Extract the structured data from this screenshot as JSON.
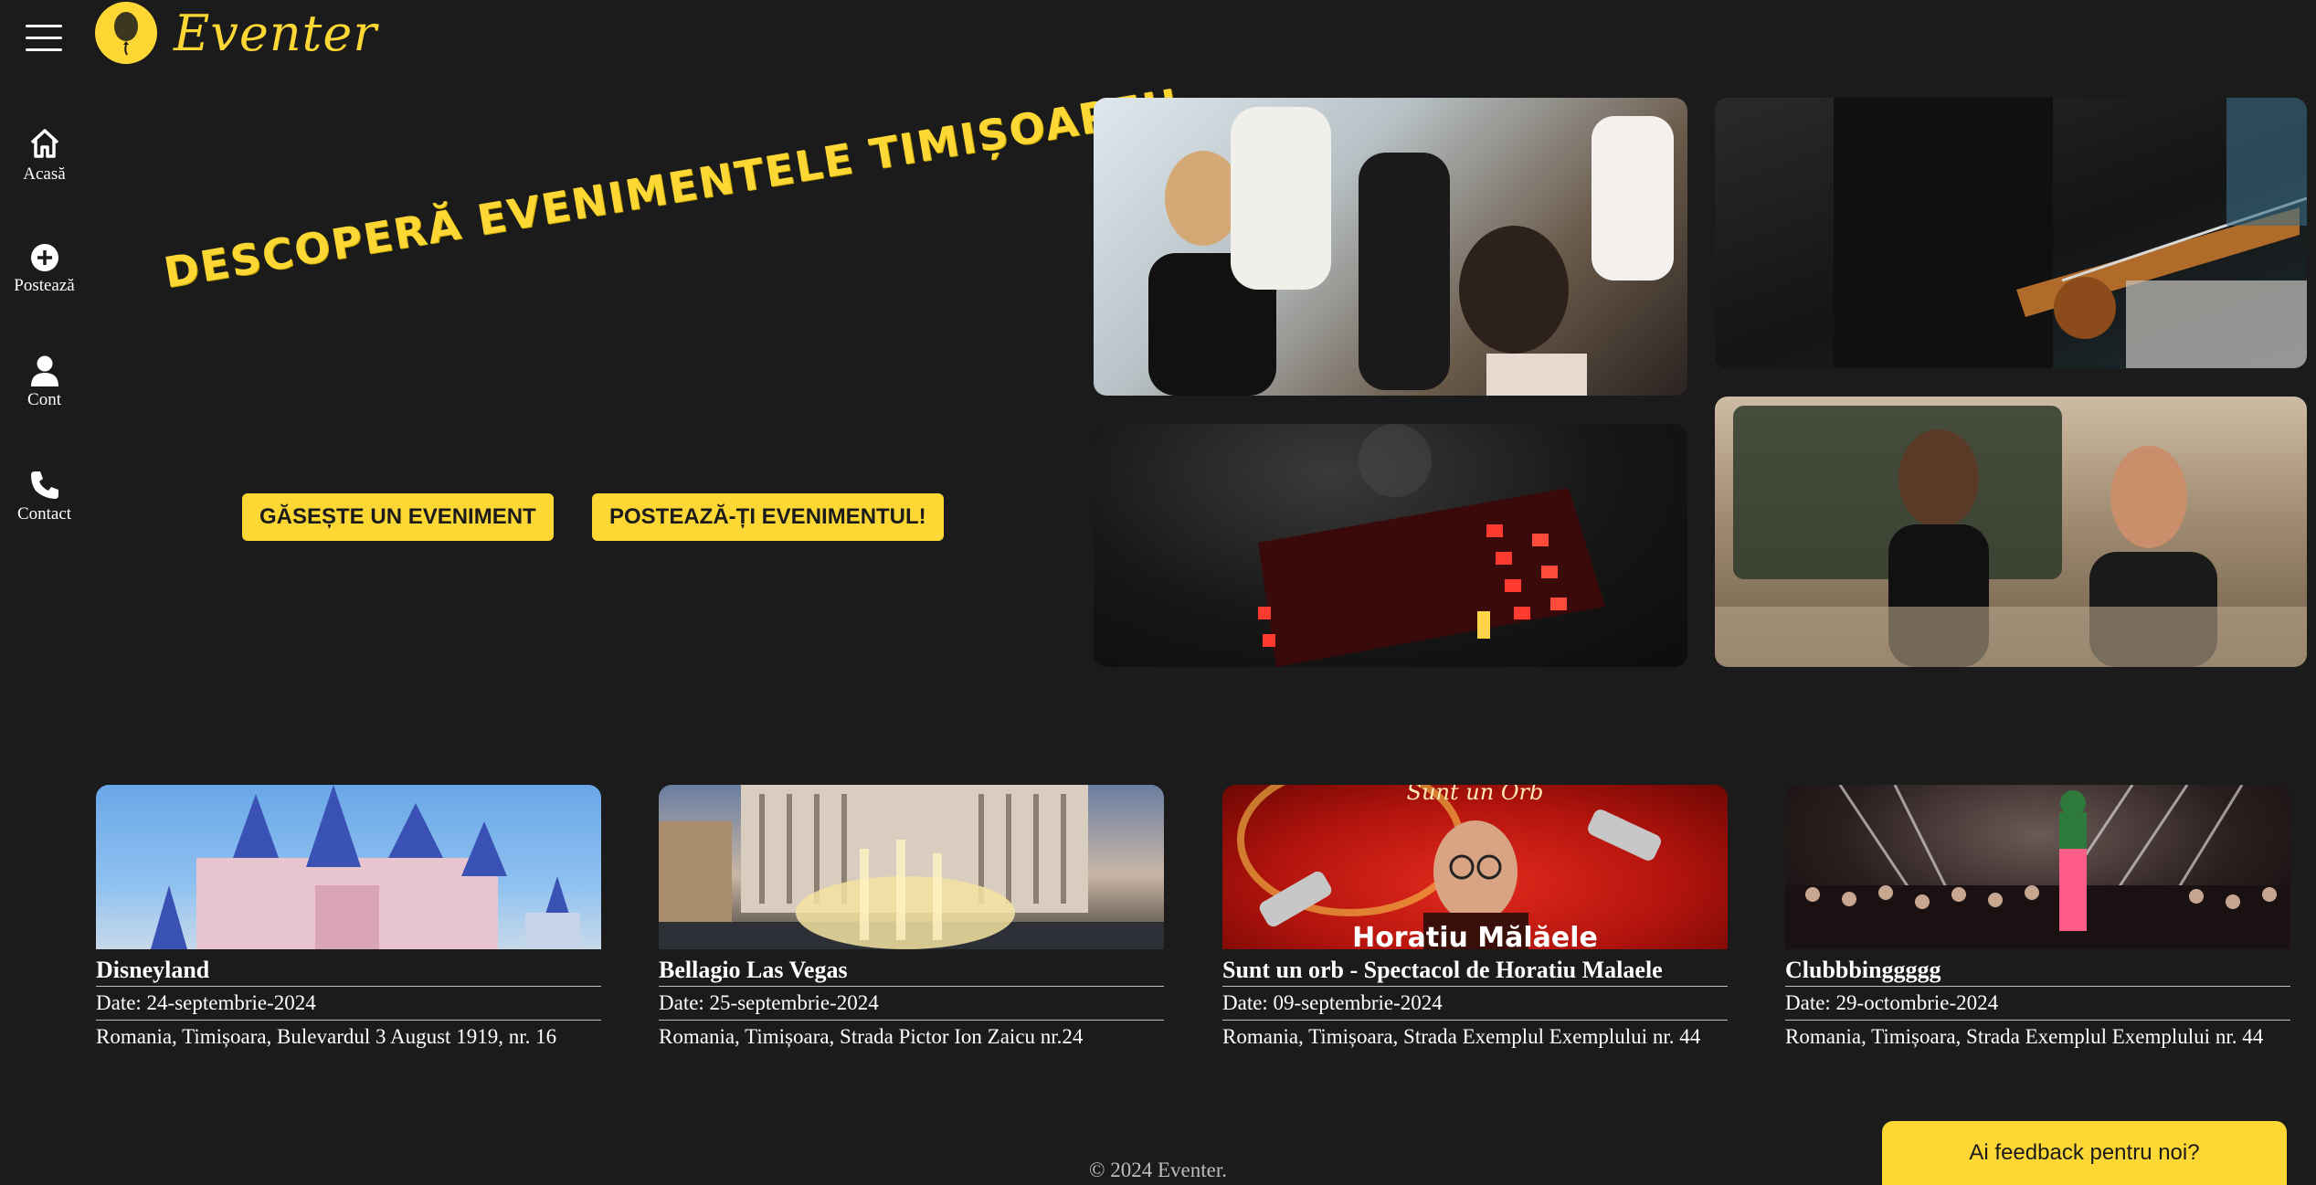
{
  "app": {
    "name": "Eventer"
  },
  "colors": {
    "accent": "#fdd835",
    "background": "#1b1b1b",
    "text": "#ffffff"
  },
  "sidebar": {
    "items": [
      {
        "label": "Acasă",
        "icon": "home-icon"
      },
      {
        "label": "Postează",
        "icon": "plus-circle-icon"
      },
      {
        "label": "Cont",
        "icon": "user-icon"
      },
      {
        "label": "Contact",
        "icon": "phone-icon"
      }
    ]
  },
  "hero": {
    "headline": "DESCOPERĂ EVENIMENTELE TIMIȘOAREI!",
    "find_button": "GĂSEȘTE UN EVENIMENT",
    "post_button": "POSTEAZĂ-ȚI EVENIMENTUL!"
  },
  "events": [
    {
      "title": "Disneyland",
      "date": "Date: 24-septembrie-2024",
      "address": "Romania, Timișoara, Bulevardul 3 August 1919, nr. 16"
    },
    {
      "title": "Bellagio Las Vegas",
      "date": "Date: 25-septembrie-2024",
      "address": "Romania, Timișoara, Strada Pictor Ion Zaicu nr.24"
    },
    {
      "title": "Sunt un orb - Spectacol de Horatiu Malaele",
      "date": "Date: 09-septembrie-2024",
      "address": "Romania, Timișoara, Strada Exemplul Exemplului nr. 44",
      "poster_top": "Sunt un Orb",
      "poster_bottom": "Horatiu Mălăele"
    },
    {
      "title": "Clubbbinggggg",
      "date": "Date: 29-octombrie-2024",
      "address": "Romania, Timișoara, Strada Exemplul Exemplului nr. 44"
    }
  ],
  "footer": {
    "copyright": "© 2024 Eventer."
  },
  "feedback": {
    "label": "Ai feedback pentru noi?"
  }
}
